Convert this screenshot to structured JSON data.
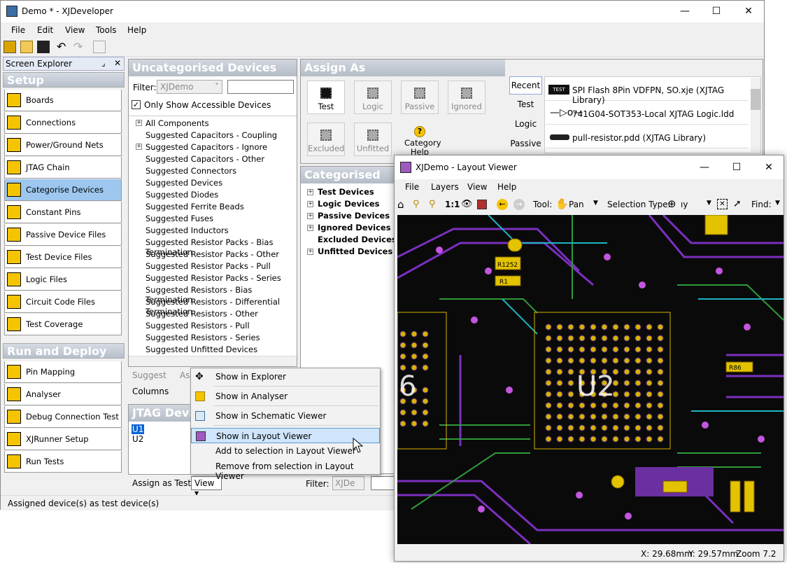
{
  "app": {
    "title": "Demo * - XJDeveloper"
  },
  "menu": [
    "File",
    "Edit",
    "View",
    "Tools",
    "Help"
  ],
  "explorer": {
    "title": "Screen Explorer",
    "setup_label": "Setup",
    "setup_items": [
      "Boards",
      "Connections",
      "Power/Ground Nets",
      "JTAG Chain",
      "Categorise Devices",
      "Constant Pins",
      "Passive Device Files",
      "Test Device Files",
      "Logic Files",
      "Circuit Code Files",
      "Test Coverage"
    ],
    "run_label": "Run and Deploy",
    "run_items": [
      "Pin Mapping",
      "Analyser",
      "Debug Connection Test",
      "XJRunner Setup",
      "Run Tests"
    ]
  },
  "uncat": {
    "title": "Uncategorised Devices",
    "filter_label": "Filter:",
    "filter_value": "XJDemo",
    "only_accessible": "Only Show Accessible Devices",
    "items": [
      "All Components",
      "Suggested Capacitors - Coupling",
      "Suggested Capacitors - Ignore",
      "Suggested Capacitors - Other",
      "Suggested Connectors",
      "Suggested Devices",
      "Suggested Diodes",
      "Suggested Ferrite Beads",
      "Suggested Fuses",
      "Suggested Inductors",
      "Suggested Resistor Packs - Bias Termination",
      "Suggested Resistor Packs - Other",
      "Suggested Resistor Packs - Pull",
      "Suggested Resistor Packs - Series",
      "Suggested Resistors - Bias Termination",
      "Suggested Resistors - Differential Termination",
      "Suggested Resistors - Other",
      "Suggested Resistors - Pull",
      "Suggested Resistors - Series",
      "Suggested Unfitted Devices"
    ],
    "suggest": "Suggest",
    "assign_partial": "Ass",
    "columns": "Columns"
  },
  "assign": {
    "title": "Assign As",
    "buttons": [
      "Test",
      "Logic",
      "Passive",
      "Ignored",
      "Excluded",
      "Unfitted"
    ],
    "category_help": "Category Help",
    "tabs": [
      "Recent",
      "Test",
      "Logic",
      "Passive"
    ],
    "recent": [
      "SPI Flash 8Pin VDFPN, SO.xje (XJTAG Library)",
      "741G04-SOT353-Local XJTAG Logic.ldd",
      "pull-resistor.pdd (XJTAG Library)"
    ]
  },
  "cat": {
    "title": "Categorised Devic",
    "items": [
      "Test Devices",
      "Logic Devices",
      "Passive Devices",
      "Ignored Devices",
      "Excluded Devices",
      "Unfitted Devices"
    ],
    "filter_label": "Filter:",
    "filter_value": "XJDe"
  },
  "jtag": {
    "title": "JTAG Devic",
    "items": [
      "U1",
      "U2"
    ],
    "assign_btn": "Assign as Test",
    "view_btn": "View"
  },
  "context": [
    "Show in Explorer",
    "Show in Analyser",
    "Show in Schematic Viewer",
    "Show in Layout Viewer",
    "Add to selection in Layout Viewer",
    "Remove from selection in Layout Viewer"
  ],
  "status": "Assigned device(s) as test device(s)",
  "layout": {
    "title": "XJDemo - Layout Viewer",
    "menu": [
      "File",
      "Layers",
      "View",
      "Help"
    ],
    "one_to_one": "1:1",
    "tool_label": "Tool:",
    "tool_value": "Pan",
    "seltype_label": "Selection Type:",
    "seltype_value": "ıy",
    "find_label": "Find:",
    "status_x": "X: 29.68mm",
    "status_y": "Y: 29.57mm",
    "status_zoom": "Zoom 7.2",
    "labels": {
      "u2": "U2",
      "u_left": "6",
      "r_a": "R1252",
      "r_b": "R1",
      "r_c": "R86"
    }
  }
}
